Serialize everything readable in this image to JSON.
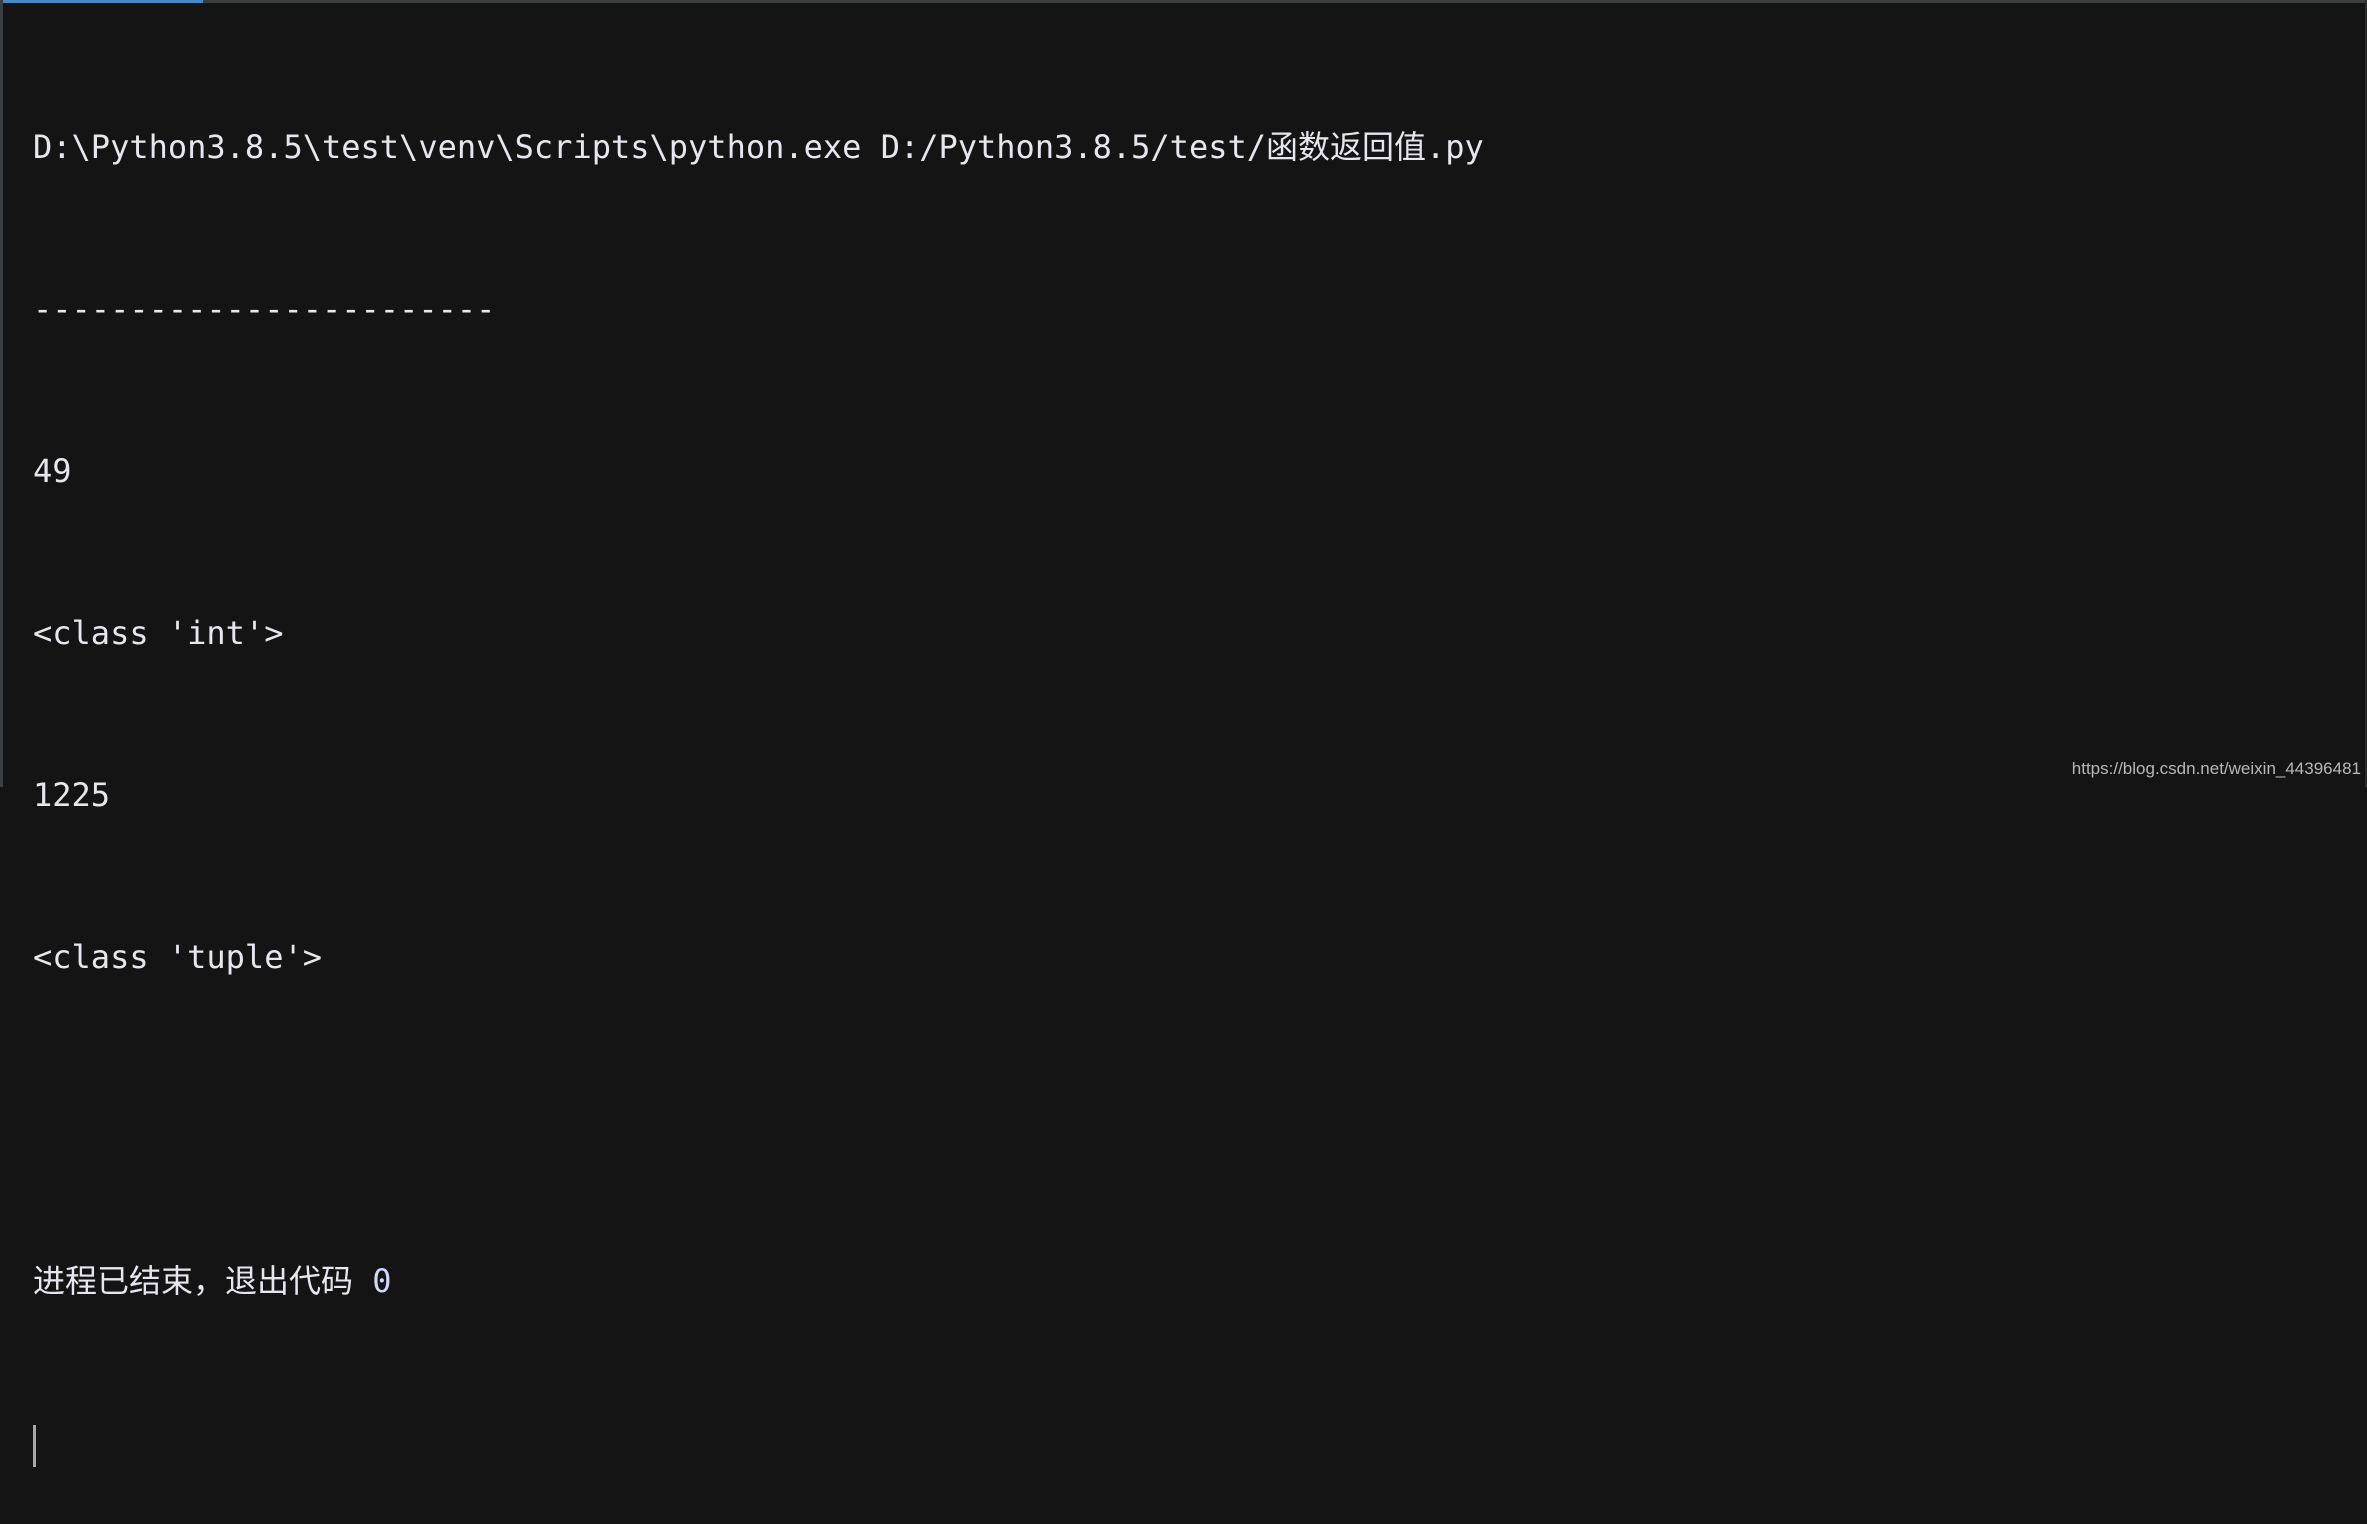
{
  "console": {
    "command": "D:\\Python3.8.5\\test\\venv\\Scripts\\python.exe D:/Python3.8.5/test/函数返回值.py",
    "output_lines": [
      "------------------------",
      "49",
      "<class 'int'>",
      "1225",
      "<class 'tuple'>"
    ],
    "exit_message": "进程已结束，退出代码 ",
    "exit_code": "0"
  },
  "watermark": "https://blog.csdn.net/weixin_44396481",
  "colors": {
    "background": "#141414",
    "text": "#e6e6ef",
    "accent": "#4a88c7"
  }
}
